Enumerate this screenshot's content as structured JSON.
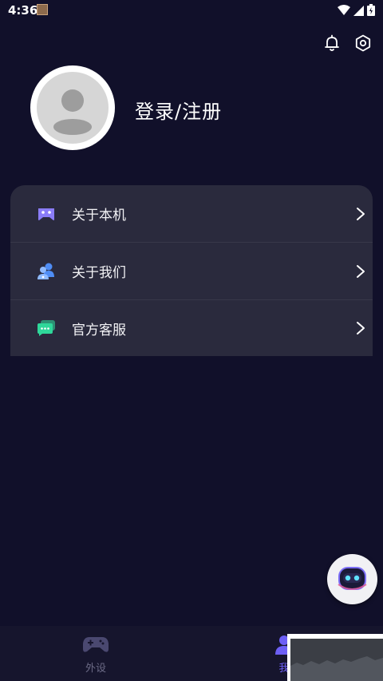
{
  "status_bar": {
    "time": "4:36",
    "icons": [
      "app-thumbnail-icon",
      "wifi-icon",
      "signal-icon",
      "battery-icon"
    ]
  },
  "header": {
    "icons": [
      "bell-icon",
      "settings-icon"
    ]
  },
  "profile": {
    "login_label": "登录/注册"
  },
  "menu": {
    "items": [
      {
        "label": "关于本机",
        "icon": "gamepad-icon",
        "color": "#8a7cf7"
      },
      {
        "label": "关于我们",
        "icon": "users-icon",
        "color": "#4f8df5"
      },
      {
        "label": "官方客服",
        "icon": "chat-icon",
        "color": "#2fd79a"
      }
    ]
  },
  "bottom_nav": {
    "items": [
      {
        "label": "外设",
        "icon": "gamepad-icon",
        "active": false
      },
      {
        "label": "我",
        "icon": "user-icon",
        "active": true
      }
    ]
  },
  "colors": {
    "background": "#11102a",
    "card": "#2a2a3d",
    "accent": "#6d5ff5"
  }
}
